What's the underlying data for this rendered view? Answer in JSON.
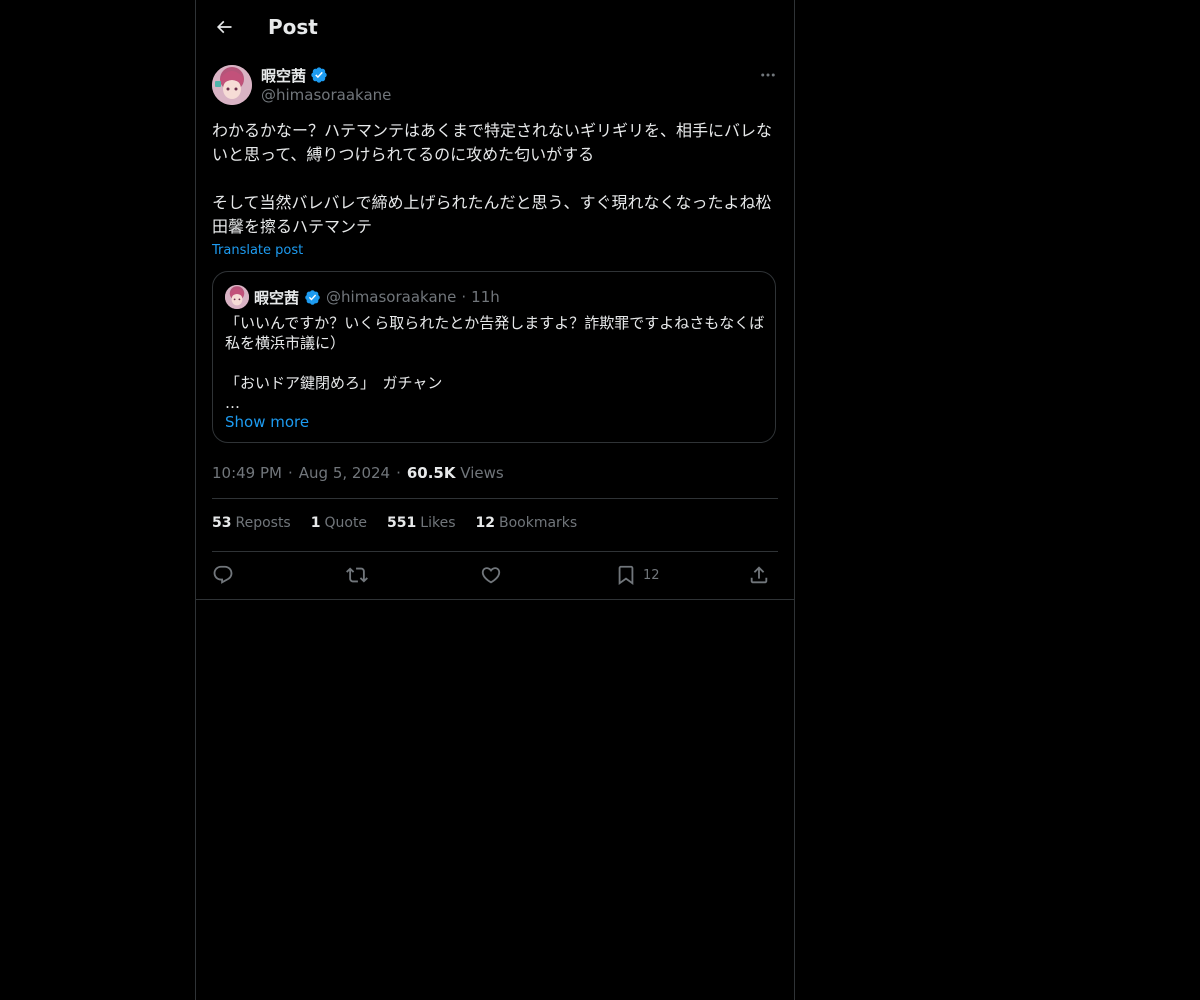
{
  "header": {
    "title": "Post",
    "back_icon": "arrow-left-icon"
  },
  "author": {
    "name": "暇空茜",
    "handle": "@himasoraakane",
    "verified_icon": "verified-badge-icon",
    "more_icon": "more-dots-icon"
  },
  "post": {
    "text": "わかるかなー？ハテマンテはあくまで特定されないギリギリを、相手にバレないと思って、縛りつけられてるのに攻めた匂いがする\n\nそして当然バレバレで締め上げられたんだと思う、すぐ現れなくなったよね松田馨を擦るハテマンテ",
    "translate_label": "Translate post"
  },
  "quote": {
    "name": "暇空茜",
    "handle": "@himasoraakane",
    "separator": "·",
    "time": "11h",
    "text": "「いいんですか？いくら取られたとか告発しますよ？詐欺罪ですよねさもなくば私を横浜市議に）\n\n「おいドア鍵閉めろ」　ガチャン\n…",
    "show_more_label": "Show more"
  },
  "meta": {
    "time": "10:49 PM",
    "separator": "·",
    "date": "Aug 5, 2024",
    "views_count": "60.5K",
    "views_label": "Views"
  },
  "stats": [
    {
      "count": "53",
      "label": "Reposts"
    },
    {
      "count": "1",
      "label": "Quote"
    },
    {
      "count": "551",
      "label": "Likes"
    },
    {
      "count": "12",
      "label": "Bookmarks"
    }
  ],
  "actions": {
    "reply_icon": "reply-icon",
    "repost_icon": "repost-icon",
    "like_icon": "heart-icon",
    "bookmark_icon": "bookmark-icon",
    "bookmark_count": "12",
    "share_icon": "share-icon"
  },
  "colors": {
    "background": "#000000",
    "text": "#e7e9ea",
    "secondary": "#71767b",
    "accent": "#1d9bf0",
    "border": "#2f3336"
  }
}
